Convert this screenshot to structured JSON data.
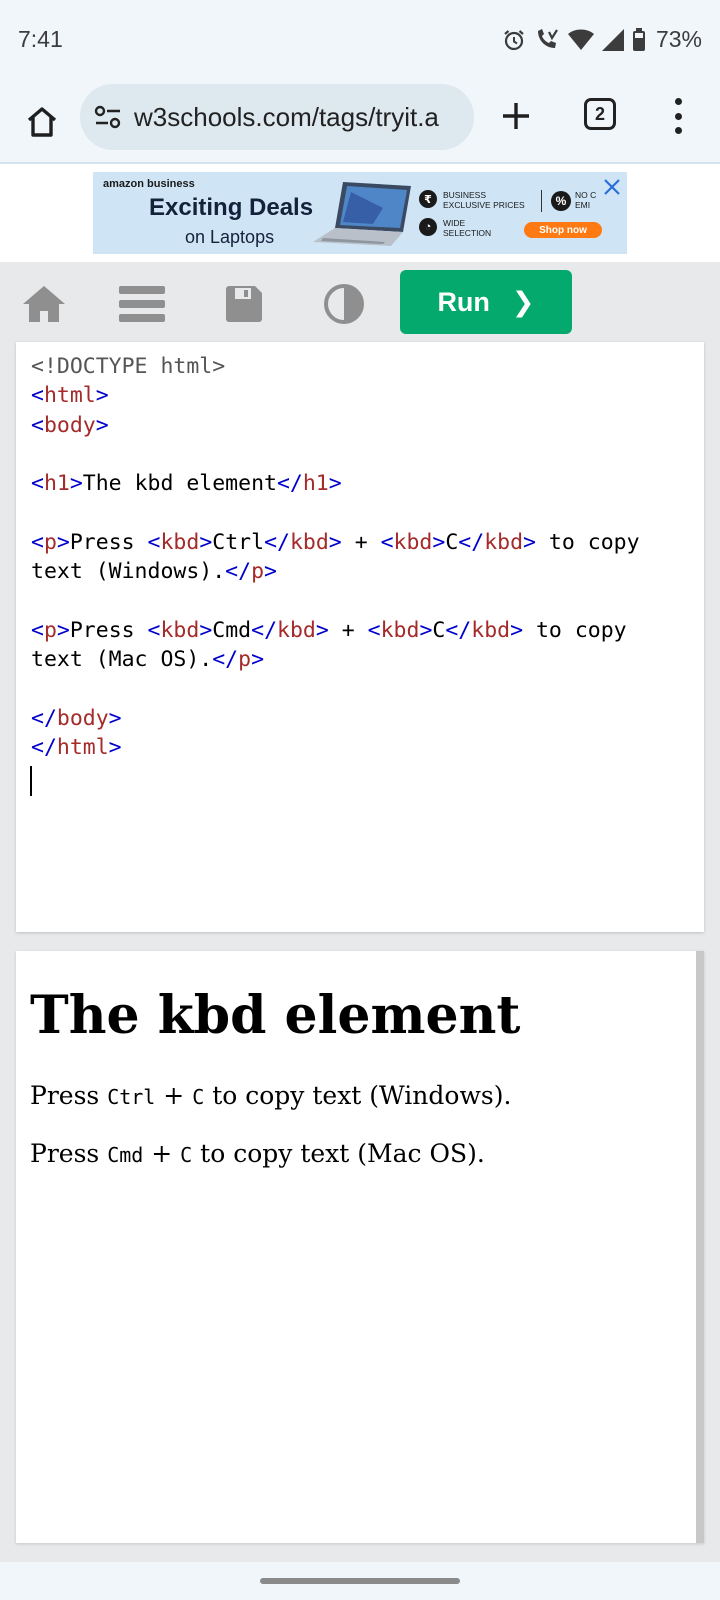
{
  "status_bar": {
    "time": "7:41",
    "battery": "73%",
    "icons": [
      "alarm-icon",
      "wifi-calling-icon",
      "wifi-icon",
      "signal-icon",
      "battery-icon"
    ]
  },
  "browser": {
    "url": "w3schools.com/tags/tryit.a",
    "tab_count": "2"
  },
  "ad": {
    "brand": "amazon business",
    "title": "Exciting Deals",
    "subtitle": "on Laptops",
    "feature1_line1": "BUSINESS",
    "feature1_line2": "EXCLUSIVE PRICES",
    "feature2_line1": "WIDE",
    "feature2_line2": "SELECTION",
    "feature3_line1": "NO C",
    "feature3_line2": "EMI",
    "cta": "Shop now"
  },
  "toolbar": {
    "run_label": "Run",
    "run_icon": "❯"
  },
  "code_lines": [
    "<!DOCTYPE html>",
    "<html>",
    "<body>",
    "",
    "<h1>The kbd element</h1>",
    "",
    "<p>Press <kbd>Ctrl</kbd> + <kbd>C</kbd> to copy",
    "text (Windows).</p>",
    "",
    "<p>Press <kbd>Cmd</kbd> + <kbd>C</kbd> to copy",
    "text (Mac OS).</p>",
    "",
    "</body>",
    "</html>"
  ],
  "result": {
    "heading": "The kbd element",
    "p1_press": "Press ",
    "p1_key1": "Ctrl",
    "p1_plus": " + ",
    "p1_key2": "C",
    "p1_rest": " to copy text (Windows).",
    "p2_press": "Press ",
    "p2_key1": "Cmd",
    "p2_plus": " + ",
    "p2_key2": "C",
    "p2_rest": " to copy text (Mac OS)."
  },
  "colors": {
    "run_button": "#04aa6d",
    "tag_bracket": "#0000cd",
    "tag_name": "#a52a2a",
    "toolbar_bg": "#e7e9eb"
  }
}
